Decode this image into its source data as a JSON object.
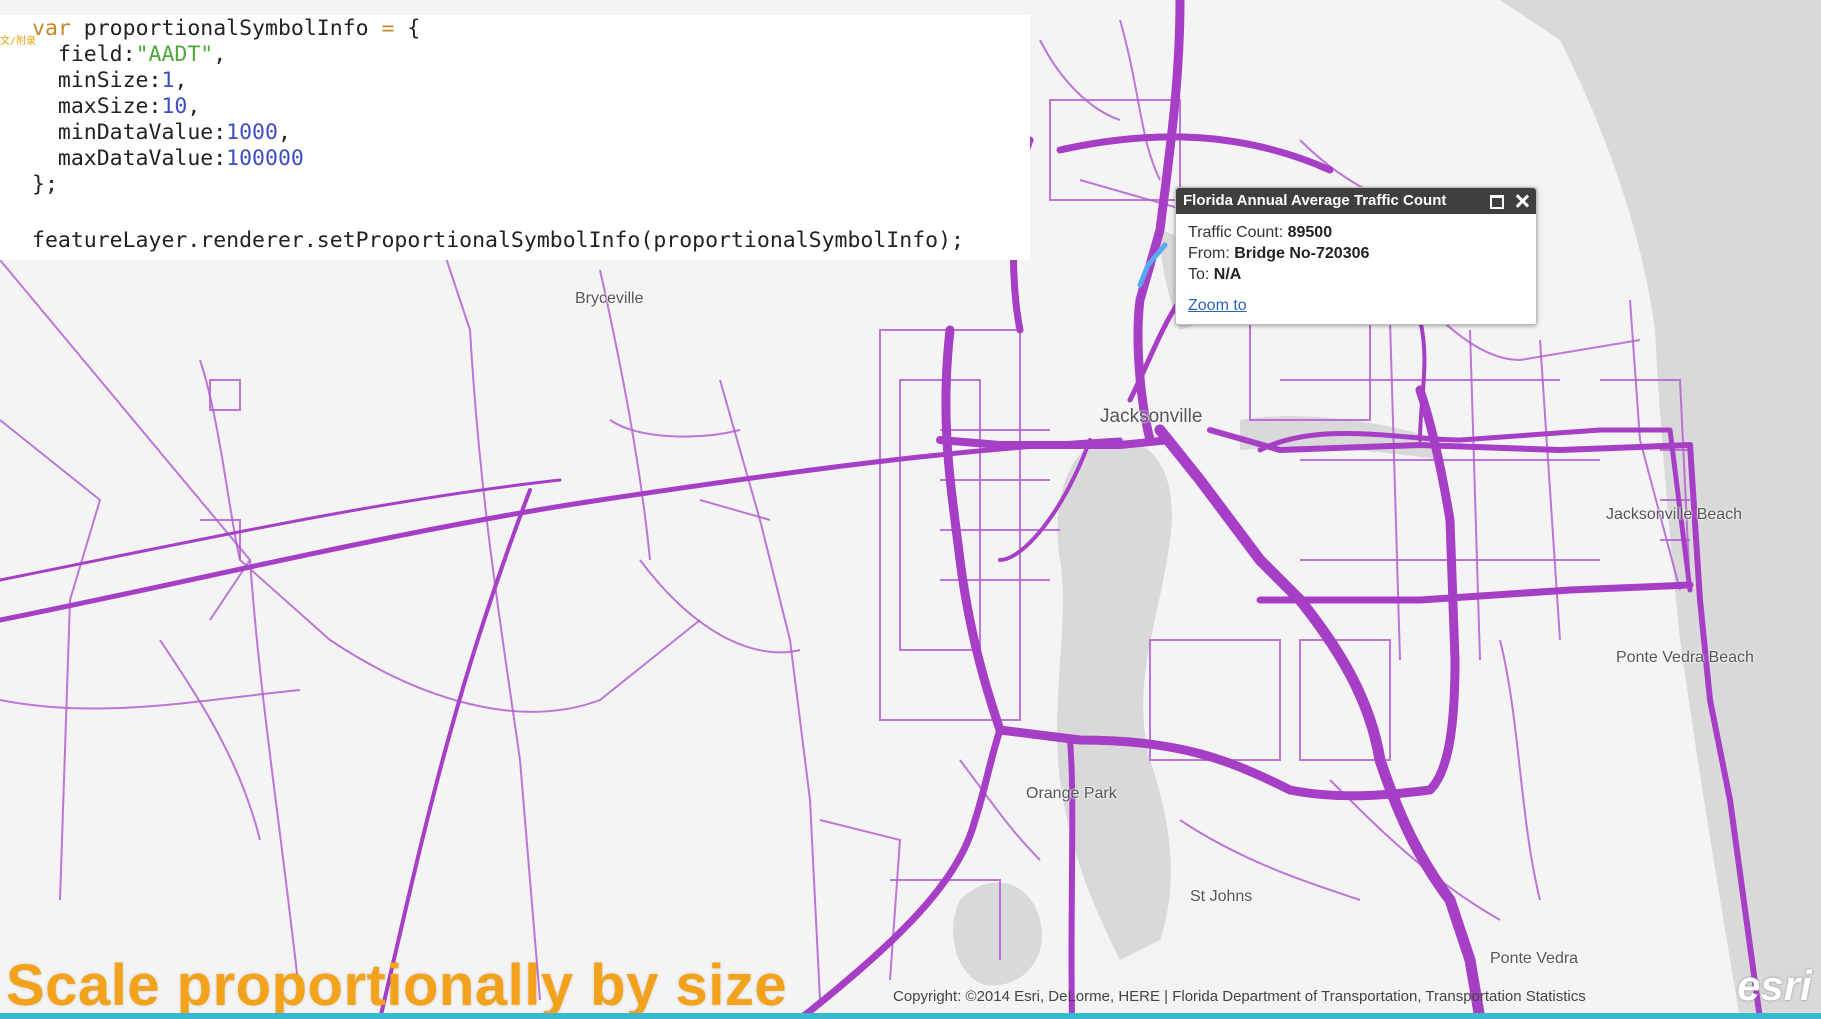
{
  "code": {
    "marker": "文/附录",
    "line1": {
      "kw": "var",
      "name": " proportionalSymbolInfo ",
      "eq": "=",
      "rest": " {"
    },
    "field": {
      "key": "  field:",
      "val": "\"AADT\"",
      "end": ","
    },
    "min_size": {
      "key": "  minSize:",
      "val": "1",
      "end": ","
    },
    "max_size": {
      "key": "  maxSize:",
      "val": "10",
      "end": ","
    },
    "min_data_value": {
      "key": "  minDataValue:",
      "val": "1000",
      "end": ","
    },
    "max_data_value": {
      "key": "  maxDataValue:",
      "val": "100000",
      "end": ""
    },
    "close": "};",
    "call": "featureLayer.renderer.setProportionalSymbolInfo(proportionalSymbolInfo);"
  },
  "popup": {
    "title": "Florida Annual Average Traffic Count",
    "traffic_label": "Traffic Count: ",
    "traffic_value": "89500",
    "from_label": "From: ",
    "from_value": "Bridge No-720306",
    "to_label": "To: ",
    "to_value": "N/A",
    "zoom_link": "Zoom to"
  },
  "places": {
    "bryceville": "Bryceville",
    "jacksonville": "Jacksonville",
    "jacksonville_beach": "Jacksonville Beach",
    "ponte_vedra_beach": "Ponte Vedra Beach",
    "orange_park": "Orange Park",
    "st_johns": "St Johns",
    "ponte_vedra": "Ponte Vedra"
  },
  "caption": "Scale proportionally by size",
  "copyright": "Copyright: ©2014 Esri, DeLorme, HERE | Florida Department of Transportation, Transportation Statistics",
  "logo": "esri",
  "colors": {
    "road": "#a63fc6",
    "road_highlight": "#5aa8f0",
    "water": "#d9d9d9",
    "land": "#f4f4f4",
    "caption": "#f2a21b"
  }
}
